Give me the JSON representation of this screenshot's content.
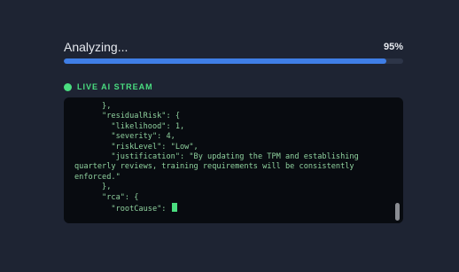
{
  "progress": {
    "label": "Analyzing...",
    "percent_text": "95%",
    "value": 0.95
  },
  "stream": {
    "title": "LIVE AI STREAM",
    "lines": [
      "      },",
      "      \"residualRisk\": {",
      "        \"likelihood\": 1,",
      "        \"severity\": 4,",
      "        \"riskLevel\": \"Low\",",
      "        \"justification\": \"By updating the TPM and establishing",
      "quarterly reviews, training requirements will be consistently",
      "enforced.\"",
      "      },",
      "      \"rca\": {",
      "        \"rootCause\": "
    ]
  },
  "colors": {
    "background": "#1e2433",
    "accent": "#3f7ee6",
    "live": "#4ade80",
    "console_bg": "#080b10",
    "console_text": "#8fd19e"
  }
}
